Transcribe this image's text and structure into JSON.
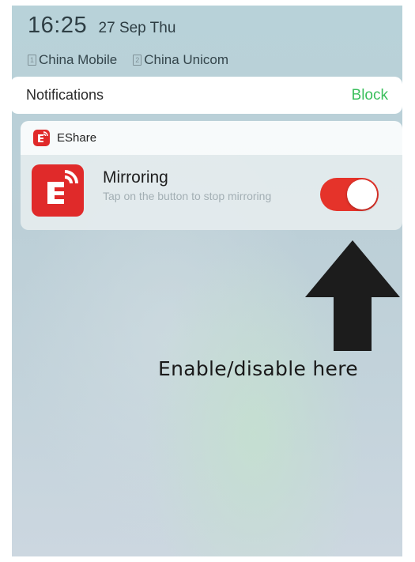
{
  "status": {
    "time": "16:25",
    "date": "27 Sep Thu",
    "carriers": [
      {
        "sim": "1",
        "name": "China Mobile"
      },
      {
        "sim": "2",
        "name": "China Unicom"
      }
    ]
  },
  "notifications_bar": {
    "title": "Notifications",
    "block_label": "Block"
  },
  "notification": {
    "app_name": "EShare",
    "title": "Mirroring",
    "subtitle": "Tap on the button to stop mirroring",
    "toggle_on": true
  },
  "annotation": {
    "text": "Enable/disable here"
  },
  "colors": {
    "accent_red": "#e5332a",
    "app_red": "#e02a2a",
    "block_green": "#3bbf5c"
  },
  "icons": {
    "app_icon": "eshare-app-icon",
    "arrow": "up-arrow-icon"
  }
}
